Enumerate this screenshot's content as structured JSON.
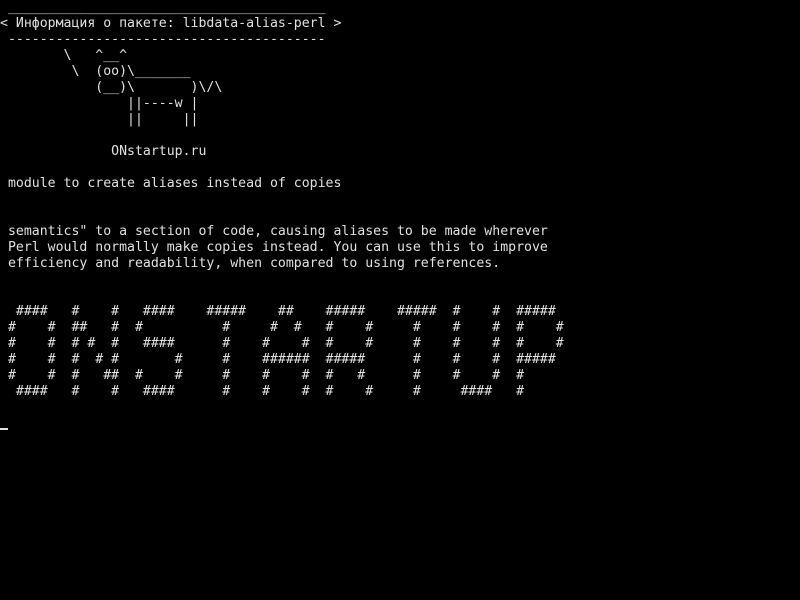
{
  "terminal": {
    "background": "#000000",
    "foreground": "#e0e0e0",
    "bubble": {
      "top_border": " ________________________________________",
      "text": "< Информация о пакете: libdata-alias-perl >",
      "bottom_border": " ----------------------------------------"
    },
    "cow": [
      "        \\   ^__^",
      "         \\  (oo)\\_______",
      "            (__)\\       )\\/\\",
      "                ||----w |",
      "                ||     ||"
    ],
    "site": "              ONstartup.ru",
    "summary": " module to create aliases instead of copies",
    "description": [
      " semantics\" to a section of code, causing aliases to be made wherever",
      " Perl would normally make copies instead. You can use this to improve",
      " efficiency and readability, when compared to using references."
    ],
    "banner": [
      "  ####   #    #   ####    #####    ##    #####    #####  #    #  #####",
      " #    #  ##   #  #          #     #  #   #    #     #    #    #  #    #",
      " #    #  # #  #   ####      #    #    #  #    #     #    #    #  #    #",
      " #    #  #  # #       #     #    ######  #####      #    #    #  #####",
      " #    #  #   ##  #    #     #    #    #  #   #      #    #    #  #",
      "  ####   #    #   ####      #    #    #  #    #     #     ####   #"
    ]
  }
}
